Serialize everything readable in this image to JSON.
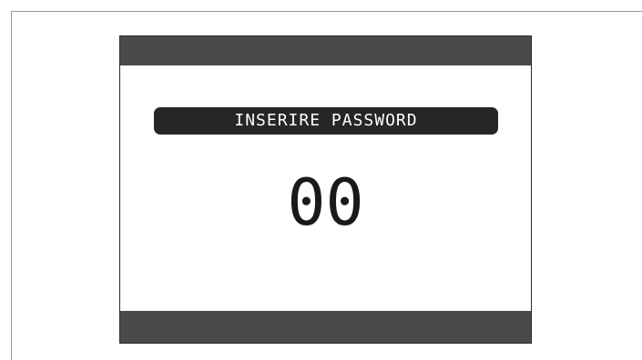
{
  "prompt": {
    "label": "INSERIRE PASSWORD"
  },
  "password": {
    "value": "00"
  },
  "colors": {
    "bar": "#4a4a4a",
    "banner": "#262626",
    "background": "#ffffff",
    "text_dark": "#1a1a1a"
  }
}
